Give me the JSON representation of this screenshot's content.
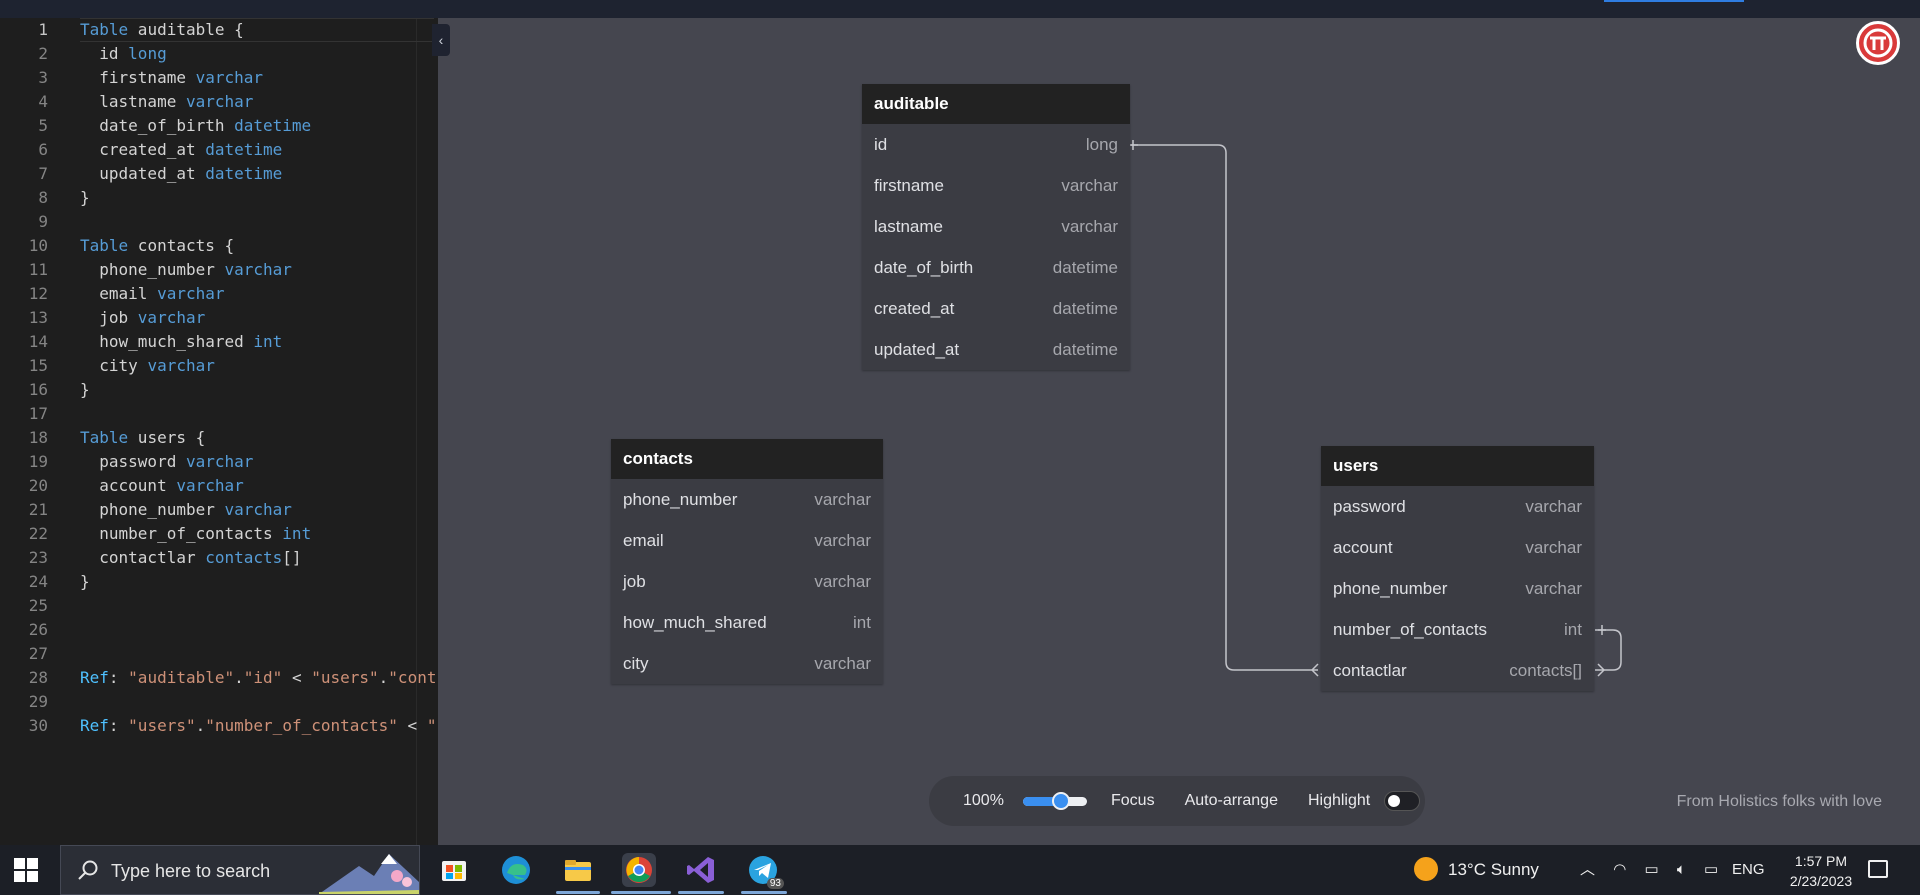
{
  "editor": {
    "active_line": 1,
    "lines": [
      [
        [
          "Table",
          "kw"
        ],
        [
          " auditable {",
          ""
        ]
      ],
      [
        [
          "  id ",
          ""
        ],
        [
          "long",
          "ty"
        ]
      ],
      [
        [
          "  firstname ",
          ""
        ],
        [
          "varchar",
          "ty"
        ]
      ],
      [
        [
          "  lastname ",
          ""
        ],
        [
          "varchar",
          "ty"
        ]
      ],
      [
        [
          "  date_of_birth ",
          ""
        ],
        [
          "datetime",
          "ty"
        ]
      ],
      [
        [
          "  created_at ",
          ""
        ],
        [
          "datetime",
          "ty"
        ]
      ],
      [
        [
          "  updated_at ",
          ""
        ],
        [
          "datetime",
          "ty"
        ]
      ],
      [
        [
          "}",
          ""
        ]
      ],
      [],
      [
        [
          "Table",
          "kw"
        ],
        [
          " contacts {",
          ""
        ]
      ],
      [
        [
          "  phone_number ",
          ""
        ],
        [
          "varchar",
          "ty"
        ]
      ],
      [
        [
          "  email ",
          ""
        ],
        [
          "varchar",
          "ty"
        ]
      ],
      [
        [
          "  job ",
          ""
        ],
        [
          "varchar",
          "ty"
        ]
      ],
      [
        [
          "  how_much_shared ",
          ""
        ],
        [
          "int",
          "ty"
        ]
      ],
      [
        [
          "  city ",
          ""
        ],
        [
          "varchar",
          "ty"
        ]
      ],
      [
        [
          "}",
          ""
        ]
      ],
      [],
      [
        [
          "Table",
          "kw"
        ],
        [
          " users {",
          ""
        ]
      ],
      [
        [
          "  password ",
          ""
        ],
        [
          "varchar",
          "ty"
        ]
      ],
      [
        [
          "  account ",
          ""
        ],
        [
          "varchar",
          "ty"
        ]
      ],
      [
        [
          "  phone_number ",
          ""
        ],
        [
          "varchar",
          "ty"
        ]
      ],
      [
        [
          "  number_of_contacts ",
          ""
        ],
        [
          "int",
          "ty"
        ]
      ],
      [
        [
          "  contactlar ",
          ""
        ],
        [
          "contacts",
          "ty"
        ],
        [
          "[]",
          ""
        ]
      ],
      [
        [
          "}",
          ""
        ]
      ],
      [],
      [],
      [],
      [
        [
          "Ref",
          "ref"
        ],
        [
          ": ",
          ""
        ],
        [
          "\"auditable\"",
          "str"
        ],
        [
          ".",
          ""
        ],
        [
          "\"id\"",
          "str"
        ],
        [
          " < ",
          ""
        ],
        [
          "\"users\"",
          "str"
        ],
        [
          ".",
          ""
        ],
        [
          "\"cont",
          "str"
        ]
      ],
      [],
      [
        [
          "Ref",
          "ref"
        ],
        [
          ": ",
          ""
        ],
        [
          "\"users\"",
          "str"
        ],
        [
          ".",
          ""
        ],
        [
          "\"number_of_contacts\"",
          "str"
        ],
        [
          " < ",
          ""
        ],
        [
          "\"",
          "str"
        ]
      ]
    ]
  },
  "tables": [
    {
      "name": "auditable",
      "fields": [
        {
          "name": "id",
          "type": "long"
        },
        {
          "name": "firstname",
          "type": "varchar"
        },
        {
          "name": "lastname",
          "type": "varchar"
        },
        {
          "name": "date_of_birth",
          "type": "datetime"
        },
        {
          "name": "created_at",
          "type": "datetime"
        },
        {
          "name": "updated_at",
          "type": "datetime"
        }
      ]
    },
    {
      "name": "contacts",
      "fields": [
        {
          "name": "phone_number",
          "type": "varchar"
        },
        {
          "name": "email",
          "type": "varchar"
        },
        {
          "name": "job",
          "type": "varchar"
        },
        {
          "name": "how_much_shared",
          "type": "int"
        },
        {
          "name": "city",
          "type": "varchar"
        }
      ]
    },
    {
      "name": "users",
      "fields": [
        {
          "name": "password",
          "type": "varchar"
        },
        {
          "name": "account",
          "type": "varchar"
        },
        {
          "name": "phone_number",
          "type": "varchar"
        },
        {
          "name": "number_of_contacts",
          "type": "int"
        },
        {
          "name": "contactlar",
          "type": "contacts[]"
        }
      ]
    }
  ],
  "toolbar": {
    "zoom": "100%",
    "zoom_level": 0.6,
    "focus": "Focus",
    "auto_arrange": "Auto-arrange",
    "highlight": "Highlight",
    "highlight_on": false
  },
  "footer_text": "From Holistics folks with love",
  "taskbar": {
    "search_placeholder": "Type here to search",
    "telegram_badge": "93",
    "weather": "13°C  Sunny",
    "language": "ENG",
    "time": "1:57 PM",
    "date": "2/23/2023"
  },
  "colors": {
    "accent": "#3a8ff0",
    "canvas": "#45464f",
    "table_header": "#222222"
  }
}
